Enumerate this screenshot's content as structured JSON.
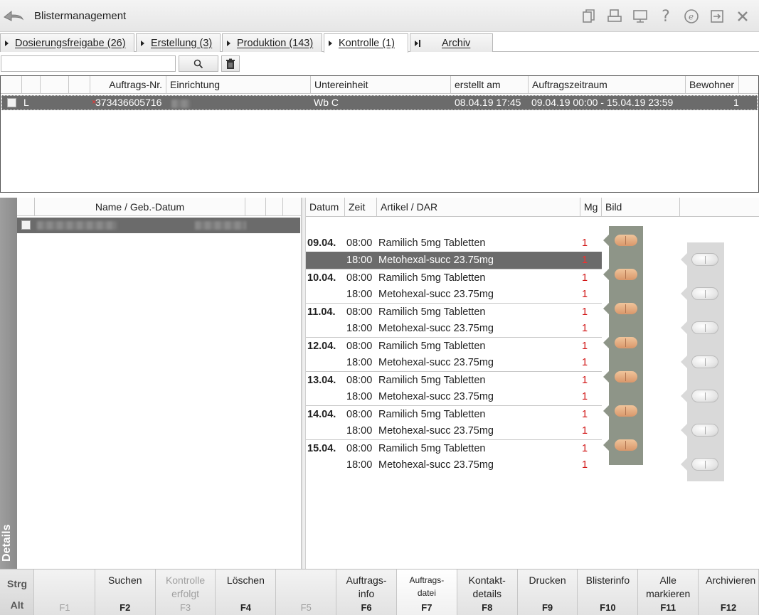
{
  "window": {
    "title": "Blistermanagement"
  },
  "toolbar_icons": [
    "copy-icon",
    "print-icon",
    "monitor-icon",
    "help-icon",
    "e-icon",
    "export-icon",
    "close-icon"
  ],
  "tabs": [
    {
      "label": "Dosierungsfreigabe (26)"
    },
    {
      "label": "Erstellung (3)"
    },
    {
      "label": "Produktion (143)"
    },
    {
      "label": "Kontrolle (1)",
      "active": true
    },
    {
      "label": "Archiv"
    }
  ],
  "search": {
    "value": "",
    "placeholder": ""
  },
  "orders": {
    "columns": [
      "Auftrags-Nr.",
      "Einrichtung",
      "Untereinheit",
      "erstellt am",
      "Auftragszeitraum",
      "Bewohner"
    ],
    "rows": [
      {
        "flag": "L",
        "order_no": "373436605716",
        "facility": "",
        "subunit": "Wb C",
        "created": "08.04.19 17:45",
        "period": "09.04.19 00:00 - 15.04.19 23:59",
        "residents": "1"
      }
    ]
  },
  "details_label": "Details",
  "residents": {
    "columns": [
      "Name / Geb.-Datum"
    ]
  },
  "meds": {
    "columns": [
      "Datum",
      "Zeit",
      "Artikel / DAR",
      "Mg",
      "Bild"
    ],
    "days": [
      {
        "date": "09.04.",
        "entries": [
          {
            "time": "08:00",
            "article": "Ramilich 5mg Tabletten",
            "mg": "1"
          },
          {
            "time": "18:00",
            "article": "Metohexal-succ 23.75mg",
            "mg": "1"
          }
        ]
      },
      {
        "date": "10.04.",
        "entries": [
          {
            "time": "08:00",
            "article": "Ramilich 5mg Tabletten",
            "mg": "1"
          },
          {
            "time": "18:00",
            "article": "Metohexal-succ 23.75mg",
            "mg": "1"
          }
        ]
      },
      {
        "date": "11.04.",
        "entries": [
          {
            "time": "08:00",
            "article": "Ramilich 5mg Tabletten",
            "mg": "1"
          },
          {
            "time": "18:00",
            "article": "Metohexal-succ 23.75mg",
            "mg": "1"
          }
        ]
      },
      {
        "date": "12.04.",
        "entries": [
          {
            "time": "08:00",
            "article": "Ramilich 5mg Tabletten",
            "mg": "1"
          },
          {
            "time": "18:00",
            "article": "Metohexal-succ 23.75mg",
            "mg": "1"
          }
        ]
      },
      {
        "date": "13.04.",
        "entries": [
          {
            "time": "08:00",
            "article": "Ramilich 5mg Tabletten",
            "mg": "1"
          },
          {
            "time": "18:00",
            "article": "Metohexal-succ 23.75mg",
            "mg": "1"
          }
        ]
      },
      {
        "date": "14.04.",
        "entries": [
          {
            "time": "08:00",
            "article": "Ramilich 5mg Tabletten",
            "mg": "1"
          },
          {
            "time": "18:00",
            "article": "Metohexal-succ 23.75mg",
            "mg": "1"
          }
        ]
      },
      {
        "date": "15.04.",
        "entries": [
          {
            "time": "08:00",
            "article": "Ramilich 5mg Tabletten",
            "mg": "1"
          },
          {
            "time": "18:00",
            "article": "Metohexal-succ 23.75mg",
            "mg": "1"
          }
        ]
      }
    ],
    "selected": {
      "day": 0,
      "entry": 1
    }
  },
  "fkeys": {
    "modifiers": [
      "Strg",
      "Alt"
    ],
    "keys": [
      {
        "key": "F1",
        "label": "",
        "disabled": true
      },
      {
        "key": "F2",
        "label": "Suchen"
      },
      {
        "key": "F3",
        "label": "Kontrolle erfolgt",
        "disabled": true
      },
      {
        "key": "F4",
        "label": "Löschen"
      },
      {
        "key": "F5",
        "label": "",
        "disabled": true
      },
      {
        "key": "F6",
        "label": "Auftrags-info"
      },
      {
        "key": "F7",
        "label": "Auftrags-datei",
        "pressed": true
      },
      {
        "key": "F8",
        "label": "Kontakt-details"
      },
      {
        "key": "F9",
        "label": "Drucken"
      },
      {
        "key": "F10",
        "label": "Blisterinfo"
      },
      {
        "key": "F11",
        "label": "Alle markieren"
      },
      {
        "key": "F12",
        "label": "Archivieren"
      }
    ]
  }
}
